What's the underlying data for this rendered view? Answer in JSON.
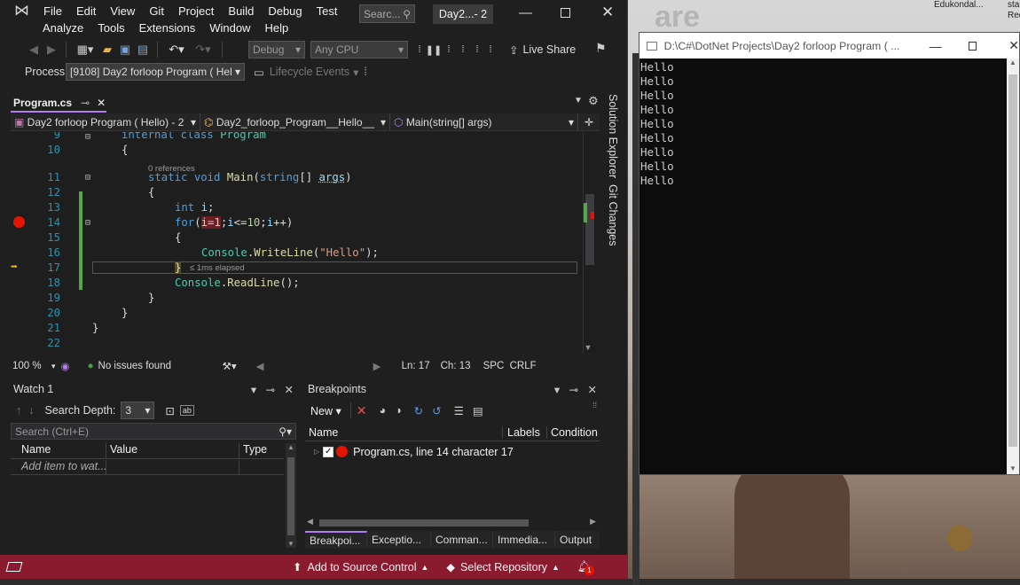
{
  "menu": {
    "row1": [
      "File",
      "Edit",
      "View",
      "Git",
      "Project",
      "Build",
      "Debug",
      "Test"
    ],
    "row2": [
      "Analyze",
      "Tools",
      "Extensions",
      "Window",
      "Help"
    ],
    "search": "Searc...",
    "window_title": "Day2...- 2"
  },
  "toolbar": {
    "config": "Debug",
    "platform": "Any CPU",
    "live_share": "Live Share",
    "process_label": "Process:",
    "process_value": "[9108] Day2 forloop Program ( Hel",
    "lifecycle": "Lifecycle Events"
  },
  "tabs": {
    "active": "Program.cs"
  },
  "navbar": {
    "project": "Day2 forloop Program ( Hello) - 2",
    "class": "Day2_forloop_Program__Hello__",
    "member": "Main(string[] args)"
  },
  "editor": {
    "line_numbers": [
      "9",
      "10",
      "",
      "11",
      "12",
      "13",
      "14",
      "15",
      "16",
      "17",
      "18",
      "19",
      "20",
      "21",
      "22"
    ],
    "references": "0 references",
    "elapsed": "≤ 1ms elapsed"
  },
  "status": {
    "zoom": "100 %",
    "issues": "No issues found",
    "line": "Ln: 17",
    "col": "Ch: 13",
    "spc": "SPC",
    "crlf": "CRLF"
  },
  "side_tabs": {
    "solution": "Solution Explorer",
    "git": "Git Changes"
  },
  "watch": {
    "title": "Watch 1",
    "search_depth_label": "Search Depth:",
    "search_depth": "3",
    "search_placeholder": "Search (Ctrl+E)",
    "cols": [
      "Name",
      "Value",
      "Type"
    ],
    "add_item": "Add item to wat..."
  },
  "breakpoints": {
    "title": "Breakpoints",
    "new": "New",
    "cols": [
      "Name",
      "Labels",
      "Condition"
    ],
    "item": "Program.cs, line 14 character 17",
    "bottom_tabs": [
      "Breakpoi...",
      "Exceptio...",
      "Comman...",
      "Immedia...",
      "Output"
    ]
  },
  "footer": {
    "source": "Add to Source Control",
    "repo": "Select Repository",
    "notif": "1"
  },
  "console": {
    "title": "D:\\C#\\DotNet Projects\\Day2 forloop Program ( ...",
    "lines": [
      "Hello",
      "Hello",
      "Hello",
      "Hello",
      "Hello",
      "Hello",
      "Hello",
      "Hello",
      "Hello"
    ]
  },
  "background": {
    "name": "Edukondal...",
    "partial1": "sta",
    "partial2": "Req"
  }
}
